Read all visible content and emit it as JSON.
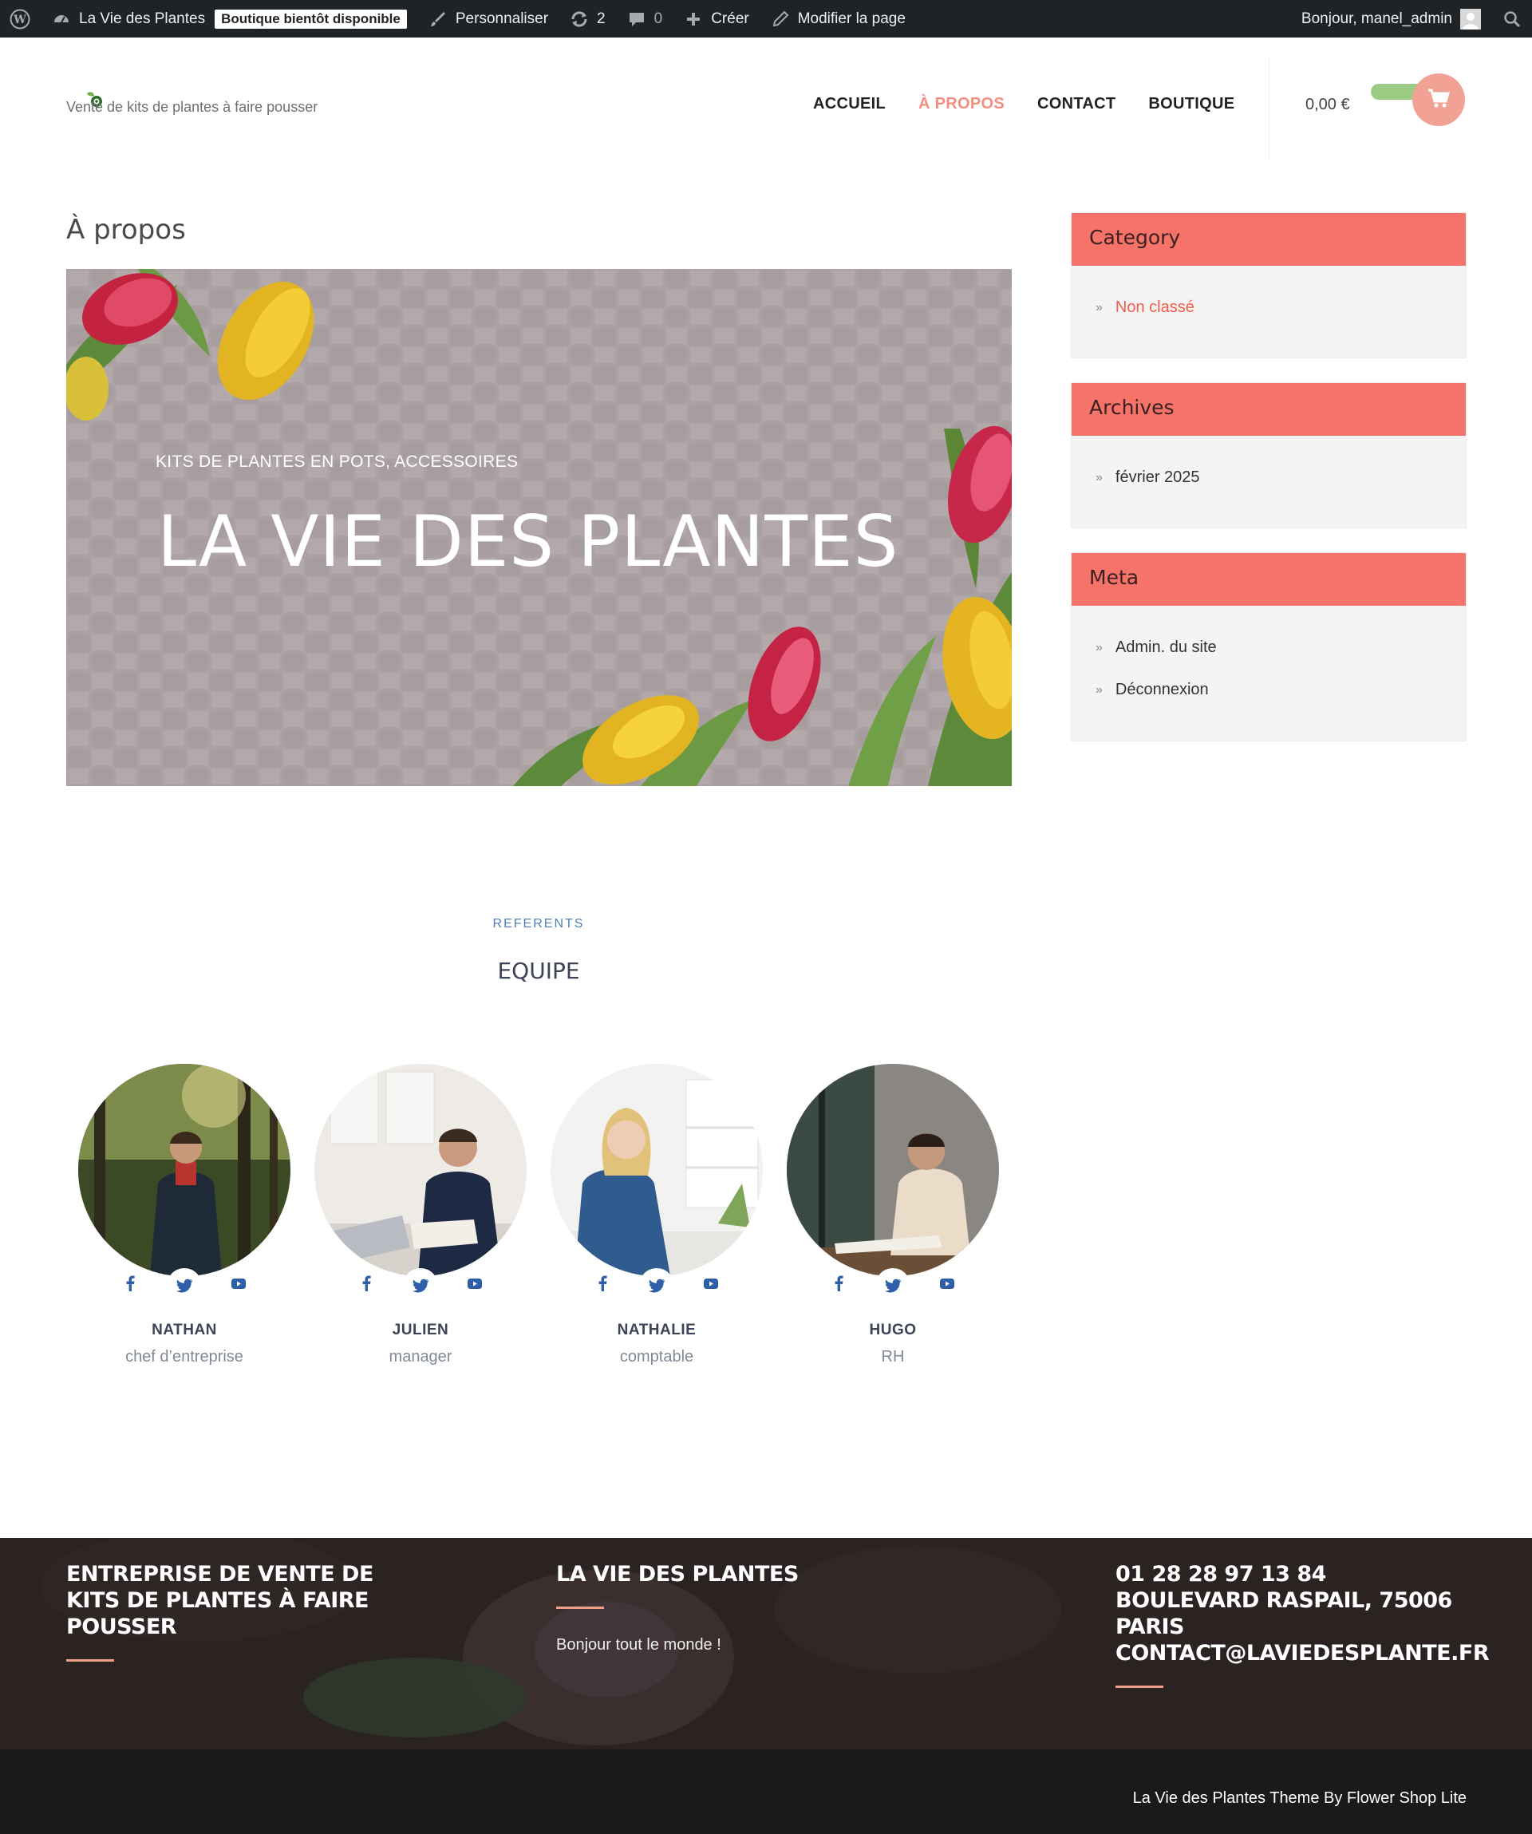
{
  "adminbar": {
    "site_name": "La Vie des Plantes",
    "badge": "Boutique bientôt disponible",
    "customize": "Personnaliser",
    "updates": "2",
    "comments": "0",
    "create": "Créer",
    "edit_page": "Modifier la page",
    "greeting": "Bonjour, manel_admin"
  },
  "header": {
    "tagline": "Vente de kits de plantes à faire pousser",
    "nav": [
      "ACCUEIL",
      "À PROPOS",
      "CONTACT",
      "BOUTIQUE"
    ],
    "cart_total": "0,00 €"
  },
  "main": {
    "page_title": "À propos",
    "hero_sub": "KITS DE PLANTES EN POTS, ACCESSOIRES",
    "hero_title": "LA VIE DES PLANTES",
    "team_kicker": "REFERENTS",
    "team_title": "EQUIPE",
    "members": [
      {
        "name": "NATHAN",
        "role": "chef d’entreprise"
      },
      {
        "name": "JULIEN",
        "role": "manager"
      },
      {
        "name": "NATHALIE",
        "role": "comptable"
      },
      {
        "name": "HUGO",
        "role": "RH"
      }
    ]
  },
  "sidebar": {
    "category": {
      "title": "Category",
      "items": [
        "Non classé"
      ]
    },
    "archives": {
      "title": "Archives",
      "items": [
        "février 2025"
      ]
    },
    "meta": {
      "title": "Meta",
      "items": [
        "Admin. du site",
        "Déconnexion"
      ]
    }
  },
  "footer": {
    "col1_title": "ENTREPRISE DE VENTE DE KITS DE PLANTES À FAIRE POUSSER",
    "col2_title": "LA VIE DES PLANTES",
    "col2_text": "Bonjour tout le monde !",
    "col3_title": "01 28 28 97 13 84 BOULEVARD RASPAIL, 75006 PARIS CONTACT@LAVIEDESPLANTE.FR",
    "credit": "La Vie des Plantes Theme By Flower Shop Lite"
  },
  "colors": {
    "accent_coral": "#f57369",
    "nav_active": "#f48f80",
    "cart_pill": "#9ccc83",
    "admin_bar": "#1d2327",
    "social_blue": "#2f5ea8"
  }
}
